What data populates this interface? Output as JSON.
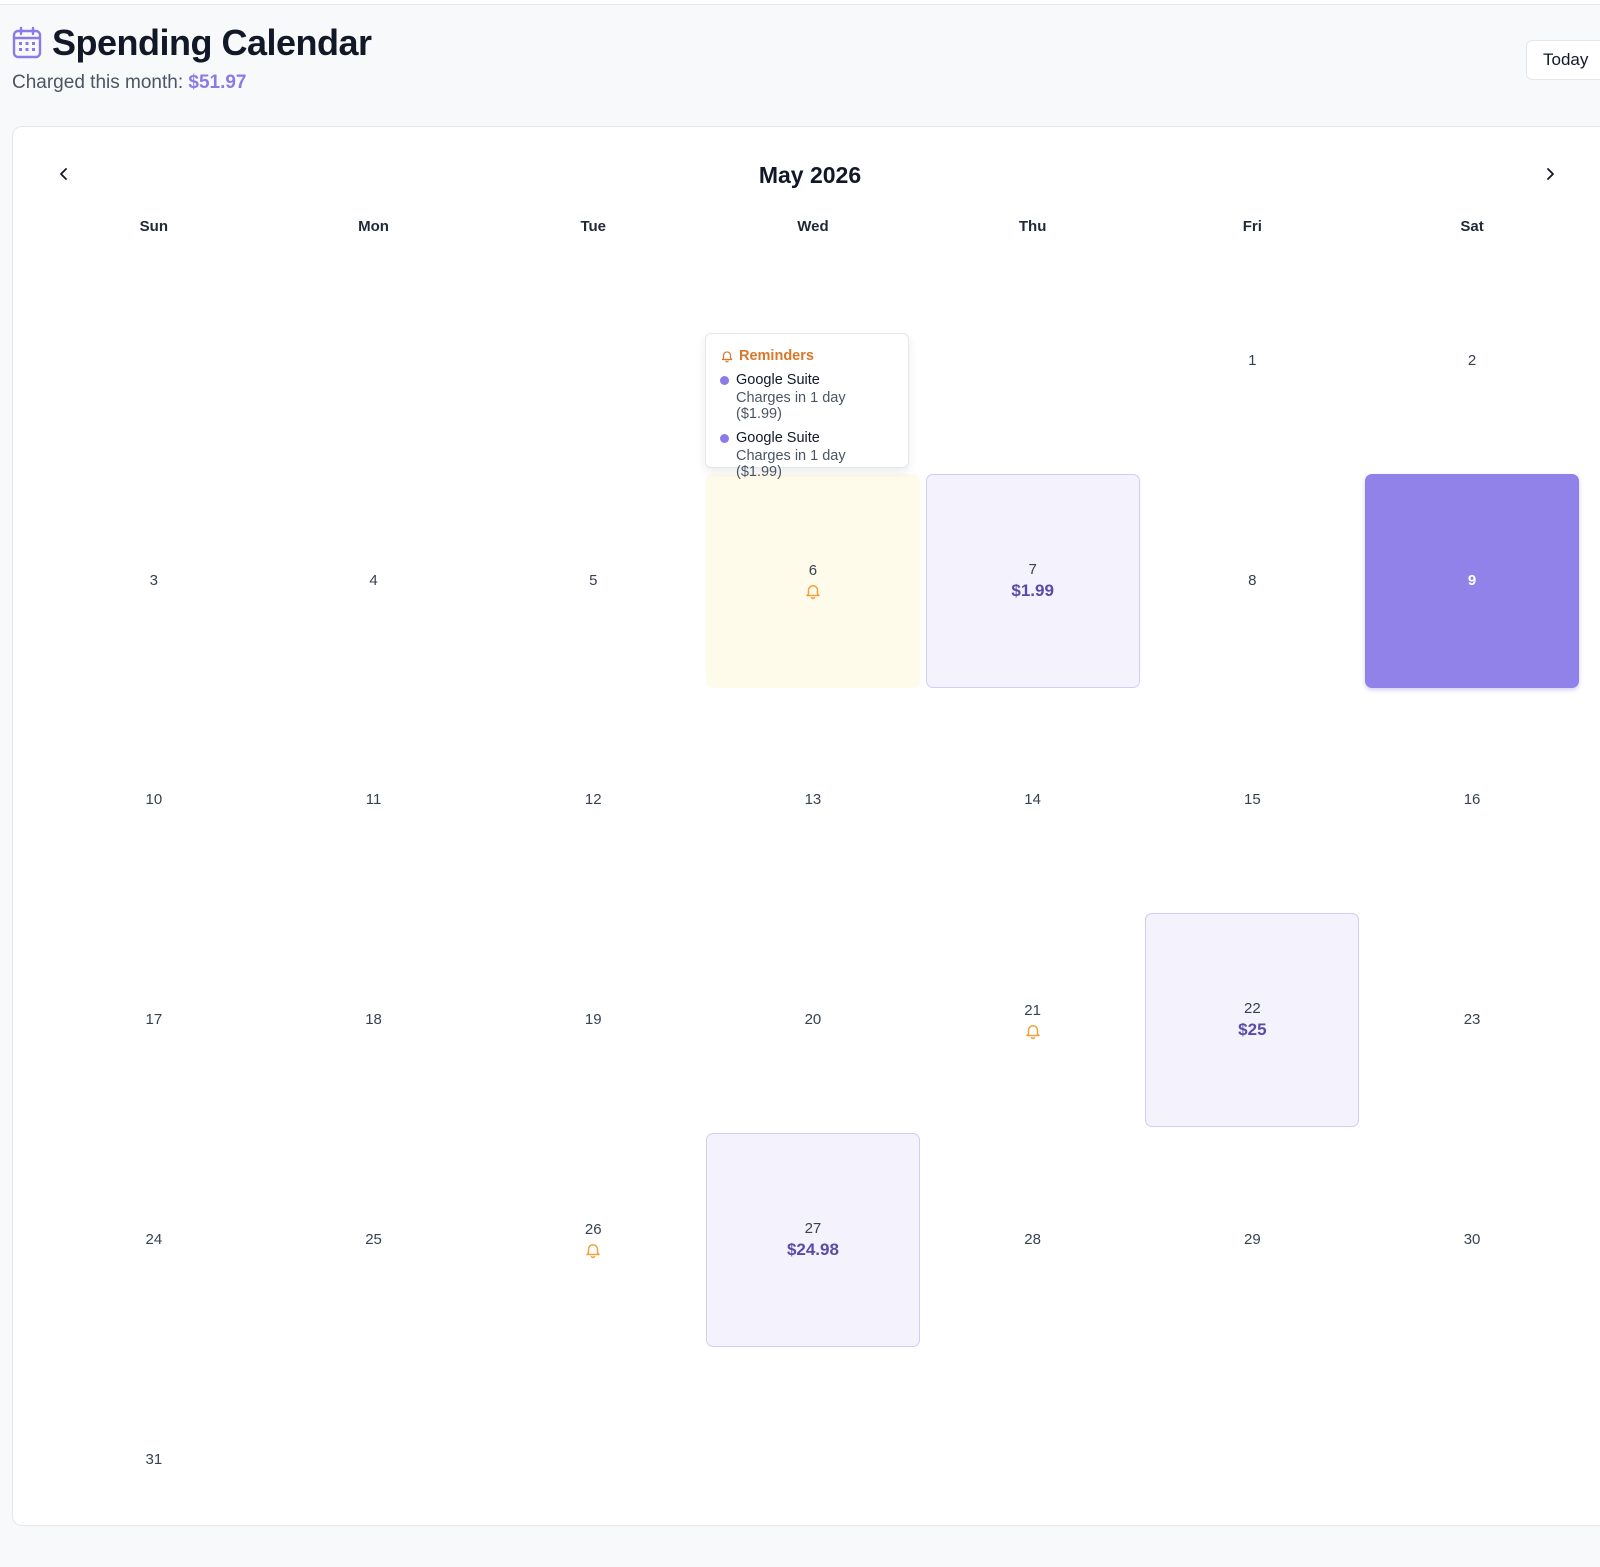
{
  "header": {
    "title": "Spending Calendar",
    "charged_label": "Charged this month:",
    "charged_amount": "$51.97",
    "today_button": "Today"
  },
  "calendar": {
    "month_title": "May 2026",
    "weekdays": [
      "Sun",
      "Mon",
      "Tue",
      "Wed",
      "Thu",
      "Fri",
      "Sat"
    ],
    "today": 9,
    "days": [
      {
        "day": 1
      },
      {
        "day": 2
      },
      {
        "day": 3
      },
      {
        "day": 4
      },
      {
        "day": 5
      },
      {
        "day": 6,
        "reminder": true,
        "highlight": "reminder"
      },
      {
        "day": 7,
        "charge": "$1.99"
      },
      {
        "day": 8
      },
      {
        "day": 9,
        "today": true
      },
      {
        "day": 10
      },
      {
        "day": 11
      },
      {
        "day": 12
      },
      {
        "day": 13
      },
      {
        "day": 14
      },
      {
        "day": 15
      },
      {
        "day": 16
      },
      {
        "day": 17
      },
      {
        "day": 18
      },
      {
        "day": 19
      },
      {
        "day": 20
      },
      {
        "day": 21,
        "reminder": true
      },
      {
        "day": 22,
        "charge": "$25"
      },
      {
        "day": 23
      },
      {
        "day": 24
      },
      {
        "day": 25
      },
      {
        "day": 26,
        "reminder": true
      },
      {
        "day": 27,
        "charge": "$24.98"
      },
      {
        "day": 28
      },
      {
        "day": 29
      },
      {
        "day": 30
      },
      {
        "day": 31
      }
    ]
  },
  "tooltip": {
    "heading": "Reminders",
    "items": [
      {
        "name": "Google Suite",
        "detail": "Charges in 1 day ($1.99)"
      },
      {
        "name": "Google Suite",
        "detail": "Charges in 1 day ($1.99)"
      }
    ]
  },
  "colors": {
    "accent": "#8b7be8",
    "today_bg": "#9182ea",
    "charged_bg": "#f4f2fd",
    "reminder_bg": "#fefbea",
    "bell": "#f0a23c",
    "reminder_heading": "#d9782a"
  },
  "icons": {
    "title_icon": "calendar-icon",
    "prev": "chevron-left-icon",
    "next": "chevron-right-icon",
    "reminder": "bell-icon"
  }
}
